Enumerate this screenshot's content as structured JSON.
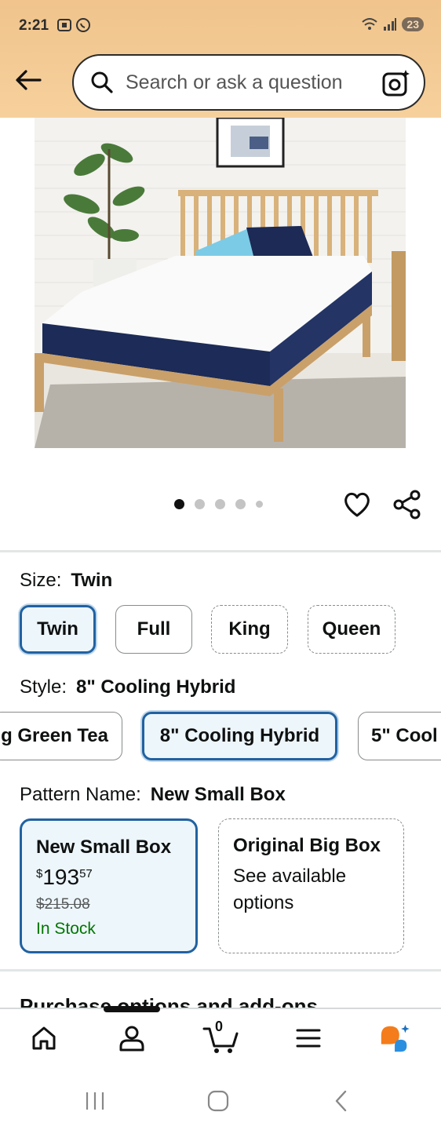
{
  "status_bar": {
    "time": "2:21",
    "battery": "23"
  },
  "search": {
    "placeholder": "Search or ask a question"
  },
  "carousel": {
    "total": 5,
    "active_index": 0
  },
  "size": {
    "label": "Size:",
    "selected": "Twin",
    "options": [
      "Twin",
      "Full",
      "King",
      "Queen"
    ]
  },
  "style": {
    "label": "Style:",
    "selected": "8\" Cooling Hybrid",
    "options": [
      "g Green Tea",
      "8\" Cooling Hybrid",
      "5\" Cool"
    ]
  },
  "pattern": {
    "label": "Pattern Name:",
    "selected": "New Small Box",
    "cards": [
      {
        "title": "New Small Box",
        "currency": "$",
        "price_whole": "193",
        "price_fraction": "57",
        "list_price": "$215.08",
        "stock": "In Stock"
      },
      {
        "title": "Original Big Box",
        "description": "See available options"
      }
    ]
  },
  "next_section_title": "Purchase options and add-ons",
  "bottom_nav": {
    "cart_count": "0"
  },
  "colors": {
    "header_bg": "#f6d09c",
    "selected_border": "#2162a1",
    "selected_bg": "#edf6fb",
    "in_stock": "#007600"
  }
}
